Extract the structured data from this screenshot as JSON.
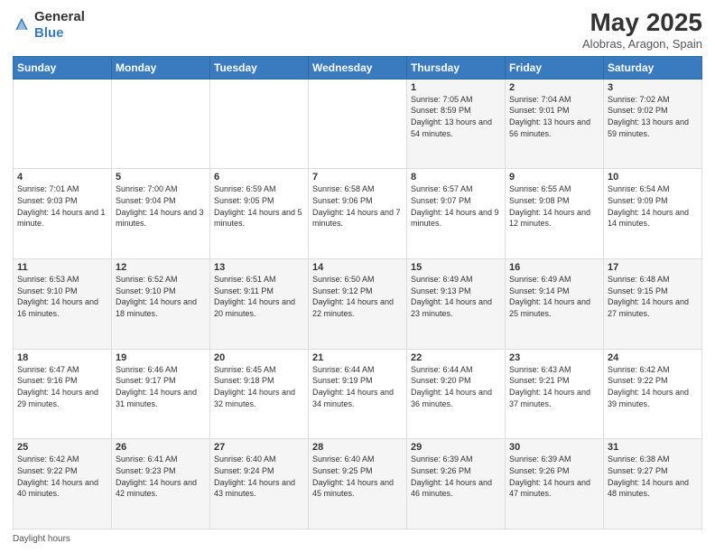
{
  "header": {
    "logo_general": "General",
    "logo_blue": "Blue",
    "main_title": "May 2025",
    "subtitle": "Alobras, Aragon, Spain"
  },
  "calendar": {
    "days_of_week": [
      "Sunday",
      "Monday",
      "Tuesday",
      "Wednesday",
      "Thursday",
      "Friday",
      "Saturday"
    ],
    "weeks": [
      [
        {
          "day": "",
          "sunrise": "",
          "sunset": "",
          "daylight": ""
        },
        {
          "day": "",
          "sunrise": "",
          "sunset": "",
          "daylight": ""
        },
        {
          "day": "",
          "sunrise": "",
          "sunset": "",
          "daylight": ""
        },
        {
          "day": "",
          "sunrise": "",
          "sunset": "",
          "daylight": ""
        },
        {
          "day": "1",
          "sunrise": "Sunrise: 7:05 AM",
          "sunset": "Sunset: 8:59 PM",
          "daylight": "Daylight: 13 hours and 54 minutes."
        },
        {
          "day": "2",
          "sunrise": "Sunrise: 7:04 AM",
          "sunset": "Sunset: 9:01 PM",
          "daylight": "Daylight: 13 hours and 56 minutes."
        },
        {
          "day": "3",
          "sunrise": "Sunrise: 7:02 AM",
          "sunset": "Sunset: 9:02 PM",
          "daylight": "Daylight: 13 hours and 59 minutes."
        }
      ],
      [
        {
          "day": "4",
          "sunrise": "Sunrise: 7:01 AM",
          "sunset": "Sunset: 9:03 PM",
          "daylight": "Daylight: 14 hours and 1 minute."
        },
        {
          "day": "5",
          "sunrise": "Sunrise: 7:00 AM",
          "sunset": "Sunset: 9:04 PM",
          "daylight": "Daylight: 14 hours and 3 minutes."
        },
        {
          "day": "6",
          "sunrise": "Sunrise: 6:59 AM",
          "sunset": "Sunset: 9:05 PM",
          "daylight": "Daylight: 14 hours and 5 minutes."
        },
        {
          "day": "7",
          "sunrise": "Sunrise: 6:58 AM",
          "sunset": "Sunset: 9:06 PM",
          "daylight": "Daylight: 14 hours and 7 minutes."
        },
        {
          "day": "8",
          "sunrise": "Sunrise: 6:57 AM",
          "sunset": "Sunset: 9:07 PM",
          "daylight": "Daylight: 14 hours and 9 minutes."
        },
        {
          "day": "9",
          "sunrise": "Sunrise: 6:55 AM",
          "sunset": "Sunset: 9:08 PM",
          "daylight": "Daylight: 14 hours and 12 minutes."
        },
        {
          "day": "10",
          "sunrise": "Sunrise: 6:54 AM",
          "sunset": "Sunset: 9:09 PM",
          "daylight": "Daylight: 14 hours and 14 minutes."
        }
      ],
      [
        {
          "day": "11",
          "sunrise": "Sunrise: 6:53 AM",
          "sunset": "Sunset: 9:10 PM",
          "daylight": "Daylight: 14 hours and 16 minutes."
        },
        {
          "day": "12",
          "sunrise": "Sunrise: 6:52 AM",
          "sunset": "Sunset: 9:10 PM",
          "daylight": "Daylight: 14 hours and 18 minutes."
        },
        {
          "day": "13",
          "sunrise": "Sunrise: 6:51 AM",
          "sunset": "Sunset: 9:11 PM",
          "daylight": "Daylight: 14 hours and 20 minutes."
        },
        {
          "day": "14",
          "sunrise": "Sunrise: 6:50 AM",
          "sunset": "Sunset: 9:12 PM",
          "daylight": "Daylight: 14 hours and 22 minutes."
        },
        {
          "day": "15",
          "sunrise": "Sunrise: 6:49 AM",
          "sunset": "Sunset: 9:13 PM",
          "daylight": "Daylight: 14 hours and 23 minutes."
        },
        {
          "day": "16",
          "sunrise": "Sunrise: 6:49 AM",
          "sunset": "Sunset: 9:14 PM",
          "daylight": "Daylight: 14 hours and 25 minutes."
        },
        {
          "day": "17",
          "sunrise": "Sunrise: 6:48 AM",
          "sunset": "Sunset: 9:15 PM",
          "daylight": "Daylight: 14 hours and 27 minutes."
        }
      ],
      [
        {
          "day": "18",
          "sunrise": "Sunrise: 6:47 AM",
          "sunset": "Sunset: 9:16 PM",
          "daylight": "Daylight: 14 hours and 29 minutes."
        },
        {
          "day": "19",
          "sunrise": "Sunrise: 6:46 AM",
          "sunset": "Sunset: 9:17 PM",
          "daylight": "Daylight: 14 hours and 31 minutes."
        },
        {
          "day": "20",
          "sunrise": "Sunrise: 6:45 AM",
          "sunset": "Sunset: 9:18 PM",
          "daylight": "Daylight: 14 hours and 32 minutes."
        },
        {
          "day": "21",
          "sunrise": "Sunrise: 6:44 AM",
          "sunset": "Sunset: 9:19 PM",
          "daylight": "Daylight: 14 hours and 34 minutes."
        },
        {
          "day": "22",
          "sunrise": "Sunrise: 6:44 AM",
          "sunset": "Sunset: 9:20 PM",
          "daylight": "Daylight: 14 hours and 36 minutes."
        },
        {
          "day": "23",
          "sunrise": "Sunrise: 6:43 AM",
          "sunset": "Sunset: 9:21 PM",
          "daylight": "Daylight: 14 hours and 37 minutes."
        },
        {
          "day": "24",
          "sunrise": "Sunrise: 6:42 AM",
          "sunset": "Sunset: 9:22 PM",
          "daylight": "Daylight: 14 hours and 39 minutes."
        }
      ],
      [
        {
          "day": "25",
          "sunrise": "Sunrise: 6:42 AM",
          "sunset": "Sunset: 9:22 PM",
          "daylight": "Daylight: 14 hours and 40 minutes."
        },
        {
          "day": "26",
          "sunrise": "Sunrise: 6:41 AM",
          "sunset": "Sunset: 9:23 PM",
          "daylight": "Daylight: 14 hours and 42 minutes."
        },
        {
          "day": "27",
          "sunrise": "Sunrise: 6:40 AM",
          "sunset": "Sunset: 9:24 PM",
          "daylight": "Daylight: 14 hours and 43 minutes."
        },
        {
          "day": "28",
          "sunrise": "Sunrise: 6:40 AM",
          "sunset": "Sunset: 9:25 PM",
          "daylight": "Daylight: 14 hours and 45 minutes."
        },
        {
          "day": "29",
          "sunrise": "Sunrise: 6:39 AM",
          "sunset": "Sunset: 9:26 PM",
          "daylight": "Daylight: 14 hours and 46 minutes."
        },
        {
          "day": "30",
          "sunrise": "Sunrise: 6:39 AM",
          "sunset": "Sunset: 9:26 PM",
          "daylight": "Daylight: 14 hours and 47 minutes."
        },
        {
          "day": "31",
          "sunrise": "Sunrise: 6:38 AM",
          "sunset": "Sunset: 9:27 PM",
          "daylight": "Daylight: 14 hours and 48 minutes."
        }
      ]
    ]
  },
  "footer": {
    "label": "Daylight hours"
  }
}
